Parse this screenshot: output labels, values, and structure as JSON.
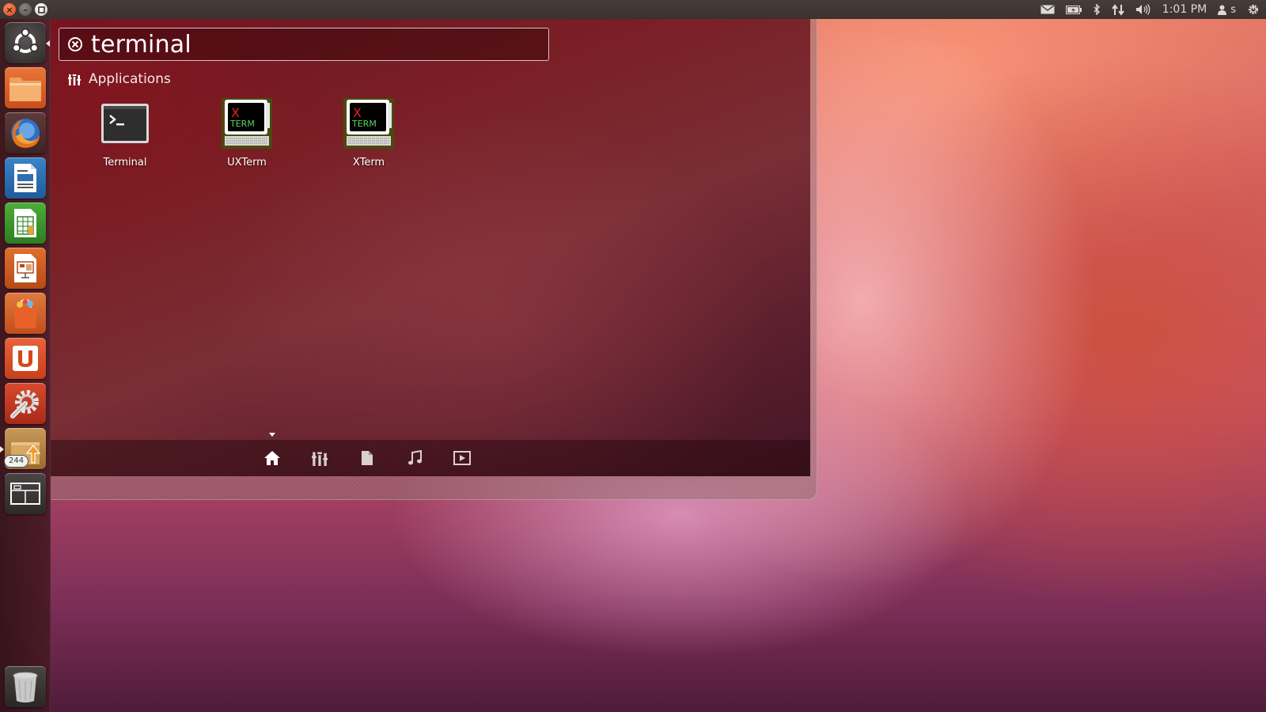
{
  "top_panel": {
    "clock": "1:01 PM",
    "user_name": "s",
    "indicators": [
      "mail-icon",
      "battery-icon",
      "bluetooth-icon",
      "network-icon",
      "volume-icon",
      "user-icon",
      "power-gear-icon"
    ]
  },
  "window_controls": [
    "close",
    "minimize",
    "maximize"
  ],
  "launcher": {
    "items": [
      {
        "name": "dash-home",
        "icon": "ubuntu-logo-icon"
      },
      {
        "name": "files",
        "icon": "folder-icon"
      },
      {
        "name": "firefox",
        "icon": "firefox-icon"
      },
      {
        "name": "writer",
        "icon": "libreoffice-writer-icon"
      },
      {
        "name": "calc",
        "icon": "libreoffice-calc-icon"
      },
      {
        "name": "impress",
        "icon": "libreoffice-impress-icon"
      },
      {
        "name": "software-center",
        "icon": "shopping-bag-icon"
      },
      {
        "name": "ubuntu-one",
        "icon": "ubuntu-one-icon"
      },
      {
        "name": "system-settings",
        "icon": "settings-wrench-icon"
      },
      {
        "name": "update-manager",
        "icon": "update-arrow-icon"
      },
      {
        "name": "workspace-switcher",
        "icon": "workspaces-icon"
      },
      {
        "name": "trash",
        "icon": "trash-icon"
      }
    ],
    "update_badge": "244"
  },
  "dash": {
    "search": {
      "query": "terminal"
    },
    "section_label": "Applications",
    "apps": [
      {
        "label": "Terminal",
        "icon": "terminal-icon"
      },
      {
        "label": "UXTerm",
        "icon": "xterm-icon"
      },
      {
        "label": "XTerm",
        "icon": "xterm-icon"
      }
    ],
    "xterm_icon_text": {
      "x": "X",
      "term": "TERM"
    },
    "lenses": [
      "home-lens-icon",
      "applications-lens-icon",
      "files-lens-icon",
      "music-lens-icon",
      "video-lens-icon"
    ],
    "active_lens": "home-lens-icon"
  },
  "colors": {
    "panel": "#3c3432",
    "launcher_bg": "#3a1520",
    "dash_bg": "#6e1a24",
    "accent_orange": "#dd4814"
  }
}
